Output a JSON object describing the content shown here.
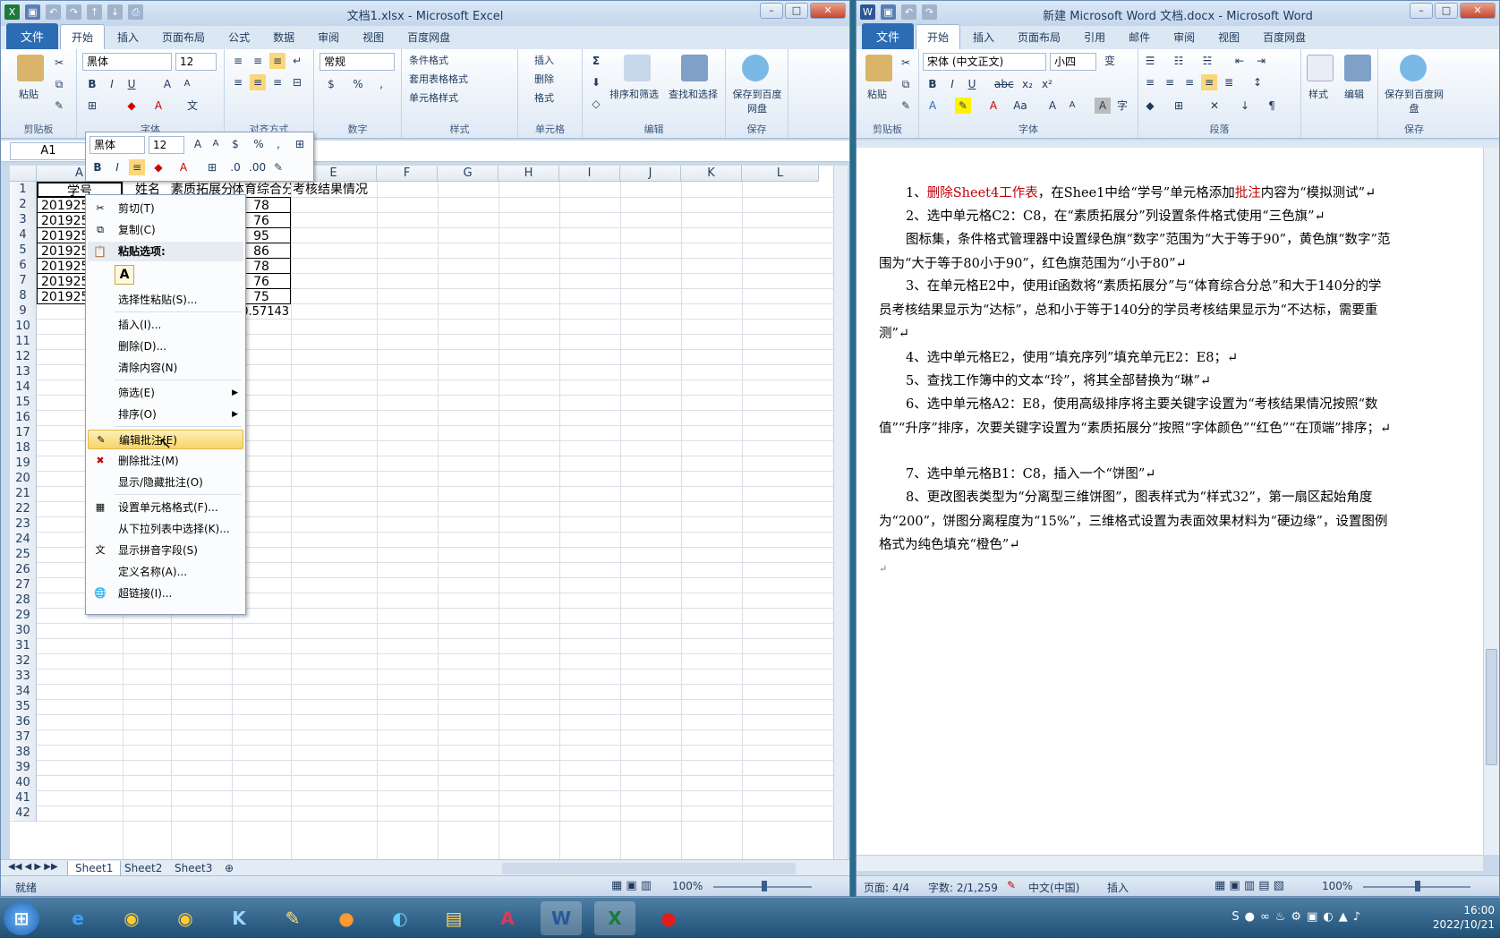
{
  "excel": {
    "title": "文档1.xlsx - Microsoft Excel",
    "tabs": {
      "file": "文件",
      "home": "开始",
      "insert": "插入",
      "layout": "页面布局",
      "formulas": "公式",
      "data": "数据",
      "review": "审阅",
      "view": "视图",
      "baidu": "百度网盘"
    },
    "ribbon": {
      "paste": "粘贴",
      "clipboard": "剪贴板",
      "font_name": "黑体",
      "font_size": "12",
      "font_group": "字体",
      "align_group": "对齐方式",
      "number_format": "常规",
      "number_group": "数字",
      "cond_format": "条件格式",
      "table_format": "套用表格格式",
      "cell_style": "单元格样式",
      "styles_group": "样式",
      "insert": "插入",
      "delete": "删除",
      "format": "格式",
      "cells_group": "单元格",
      "sort_filter": "排序和筛选",
      "find_select": "查找和选择",
      "edit_group": "编辑",
      "save_baidu": "保存到百度网盘",
      "save_group": "保存"
    },
    "name_box": "A1",
    "columns": [
      "A",
      "B",
      "C",
      "D",
      "E",
      "F",
      "G",
      "H",
      "I",
      "J",
      "K",
      "L"
    ],
    "rows": [
      "1",
      "2",
      "3",
      "4",
      "5",
      "6",
      "7",
      "8",
      "9",
      "10",
      "11",
      "12",
      "13",
      "14",
      "15",
      "16",
      "17",
      "18",
      "19",
      "20",
      "21",
      "22",
      "23",
      "24",
      "25",
      "26",
      "27",
      "28",
      "29",
      "30",
      "31",
      "32",
      "33",
      "34",
      "35",
      "36",
      "37",
      "38",
      "39",
      "40",
      "41",
      "42"
    ],
    "header_row": {
      "a": "学号",
      "b": "姓名",
      "c": "素质拓展分",
      "d": "体育综合分",
      "e": "考核结果情况"
    },
    "col_a": [
      "201925",
      "201925",
      "201925",
      "201925",
      "201925",
      "201925",
      "201925"
    ],
    "col_d": [
      "78",
      "76",
      "95",
      "86",
      "78",
      "76",
      "75"
    ],
    "d9": "80.57143",
    "sheets": [
      "Sheet1",
      "Sheet2",
      "Sheet3"
    ],
    "status": "就绪",
    "zoom": "100%",
    "mini_toolbar": {
      "font": "黑体",
      "size": "12"
    },
    "context_menu": {
      "cut": "剪切(T)",
      "copy": "复制(C)",
      "paste_options": "粘贴选项:",
      "paste_a": "A",
      "paste_special": "选择性粘贴(S)...",
      "insert": "插入(I)...",
      "delete": "删除(D)...",
      "clear": "清除内容(N)",
      "filter": "筛选(E)",
      "sort": "排序(O)",
      "edit_comment": "编辑批注(E)",
      "delete_comment": "删除批注(M)",
      "show_hide_comment": "显示/隐藏批注(O)",
      "format_cells": "设置单元格格式(F)...",
      "pick_list": "从下拉列表中选择(K)...",
      "phonetic": "显示拼音字段(S)",
      "define_name": "定义名称(A)...",
      "hyperlink": "超链接(I)..."
    }
  },
  "word": {
    "title": "新建 Microsoft Word 文档.docx - Microsoft Word",
    "tabs": {
      "file": "文件",
      "home": "开始",
      "insert": "插入",
      "layout": "页面布局",
      "refs": "引用",
      "mail": "邮件",
      "review": "审阅",
      "view": "视图",
      "baidu": "百度网盘"
    },
    "ribbon": {
      "paste": "粘贴",
      "clipboard": "剪贴板",
      "font_name": "宋体 (中文正文)",
      "font_size": "小四",
      "font_group": "字体",
      "para_group": "段落",
      "styles": "样式",
      "edit": "编辑",
      "save_baidu": "保存到百度网盘",
      "save_group": "保存"
    },
    "paragraphs": {
      "p1a": "1、",
      "p1b": "删除Sheet4工作表",
      "p1c": "，在Shee1中给“学号”单元格添加",
      "p1d": "批注",
      "p1e": "内容为“模拟测试”↵",
      "p2": "2、选中单元格C2：C8，在“素质拓展分”列设置条件格式使用“三色旗”↵",
      "p3": "图标集，条件格式管理器中设置绿色旗“数字”范围为“大于等于90”，黄色旗“数字”范围为“大于等于80小于90”，红色旗范围为“小于80”↵",
      "p4": "3、在单元格E2中，使用if函数将“素质拓展分”与“体育综合分总”和大于140分的学员考核结果显示为“达标”，总和小于等于140分的学员考核结果显示为“不达标，需要重测”↵",
      "p5": "4、选中单元格E2，使用“填充序列”填充单元E2：E8；↵",
      "p6": "5、查找工作簿中的文本“玲”，将其全部替换为“琳”↵",
      "p7": "6、选中单元格A2：E8，使用高级排序将主要关键字设置为“考核结果情况按照“数值”“升序”排序，次要关键字设置为“素质拓展分”按照“字体颜色”“红色”“在顶端”排序；↵",
      "p8": "7、选中单元格B1：C8，插入一个“饼图”↵",
      "p9": "8、更改图表类型为“分离型三维饼图”，图表样式为“样式32”，第一扇区起始角度为“200”，饼图分离程度为“15%”，三维格式设置为表面效果材料为“硬边缘”，设置图例格式为纯色填充“橙色”↵",
      "p10": "↵"
    },
    "status": {
      "page": "页面: 4/4",
      "words": "字数: 2/1,259",
      "lang": "中文(中国)",
      "mode": "插入",
      "zoom": "100%"
    }
  },
  "taskbar": {
    "time": "16:00",
    "date": "2022/10/21"
  }
}
